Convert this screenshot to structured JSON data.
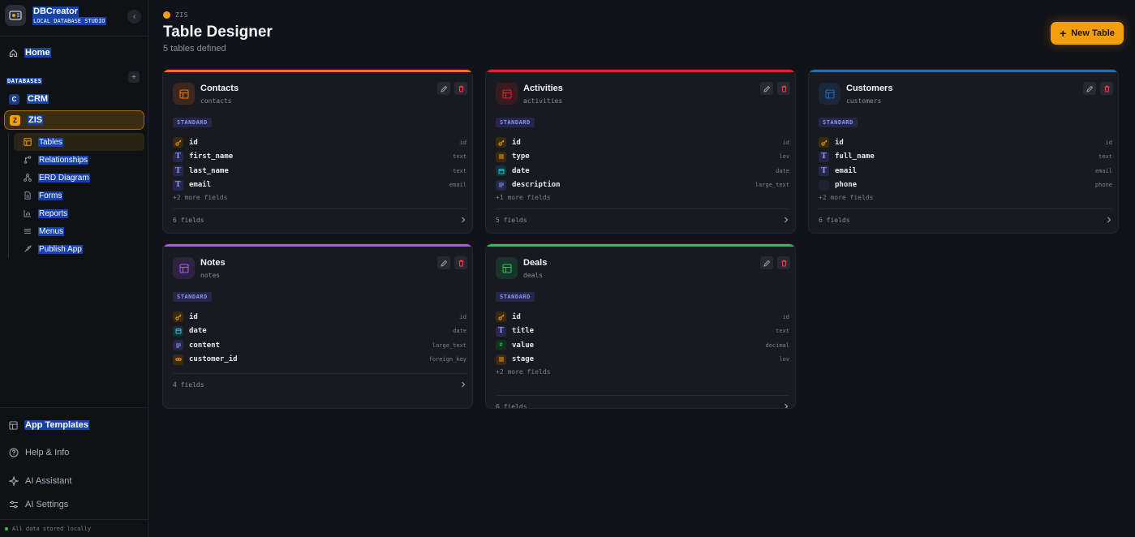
{
  "app": {
    "name": "DBCreator",
    "subtitle": "LOCAL DATABASE STUDIO"
  },
  "sidebar": {
    "home_label": "Home",
    "databases_label": "DATABASES",
    "databases": [
      {
        "letter": "C",
        "label": "CRM",
        "color": "#1e3a8a"
      },
      {
        "letter": "Z",
        "label": "ZIS",
        "color": "#f59e0b"
      }
    ],
    "sub_items": [
      {
        "label": "Tables",
        "icon": "table-icon"
      },
      {
        "label": "Relationships",
        "icon": "branch-icon"
      },
      {
        "label": "ERD Diagram",
        "icon": "diagram-icon"
      },
      {
        "label": "Forms",
        "icon": "form-icon"
      },
      {
        "label": "Reports",
        "icon": "chart-icon"
      },
      {
        "label": "Menus",
        "icon": "menu-icon"
      },
      {
        "label": "Publish App",
        "icon": "rocket-icon"
      }
    ],
    "bottom": {
      "templates": "App Templates",
      "help": "Help & Info",
      "assistant": "AI Assistant",
      "settings": "AI Settings"
    },
    "footer": "All data stored locally"
  },
  "header": {
    "crumb": "ZIS",
    "title": "Table Designer",
    "subtitle": "5 tables defined",
    "new_button": "New Table"
  },
  "tables": [
    {
      "name": "Contacts",
      "slug": "contacts",
      "color": "#f97316",
      "badge": "STANDARD",
      "fields": [
        {
          "name": "id",
          "type": "id",
          "kind": "key"
        },
        {
          "name": "first_name",
          "type": "text",
          "kind": "text"
        },
        {
          "name": "last_name",
          "type": "text",
          "kind": "text"
        },
        {
          "name": "email",
          "type": "email",
          "kind": "text"
        }
      ],
      "more": "+2 more fields",
      "count": "6 fields"
    },
    {
      "name": "Activities",
      "slug": "activities",
      "color": "#dc2626",
      "badge": "STANDARD",
      "fields": [
        {
          "name": "id",
          "type": "id",
          "kind": "key"
        },
        {
          "name": "type",
          "type": "lov",
          "kind": "lov"
        },
        {
          "name": "date",
          "type": "date",
          "kind": "date"
        },
        {
          "name": "description",
          "type": "large_text",
          "kind": "large"
        }
      ],
      "more": "+1 more fields",
      "count": "5 fields"
    },
    {
      "name": "Customers",
      "slug": "customers",
      "color": "#1d6fb8",
      "badge": "STANDARD",
      "fields": [
        {
          "name": "id",
          "type": "id",
          "kind": "key"
        },
        {
          "name": "full_name",
          "type": "text",
          "kind": "text"
        },
        {
          "name": "email",
          "type": "email",
          "kind": "text"
        },
        {
          "name": "phone",
          "type": "phone",
          "kind": "phone"
        }
      ],
      "more": "+2 more fields",
      "count": "6 fields"
    },
    {
      "name": "Notes",
      "slug": "notes",
      "color": "#a855f7",
      "badge": "STANDARD",
      "fields": [
        {
          "name": "id",
          "type": "id",
          "kind": "key"
        },
        {
          "name": "date",
          "type": "date",
          "kind": "date"
        },
        {
          "name": "content",
          "type": "large_text",
          "kind": "large"
        },
        {
          "name": "customer_id",
          "type": "foreign_key",
          "kind": "fk"
        }
      ],
      "more": "",
      "count": "4 fields"
    },
    {
      "name": "Deals",
      "slug": "deals",
      "color": "#22c55e",
      "badge": "STANDARD",
      "fields": [
        {
          "name": "id",
          "type": "id",
          "kind": "key"
        },
        {
          "name": "title",
          "type": "text",
          "kind": "text"
        },
        {
          "name": "value",
          "type": "decimal",
          "kind": "decimal"
        },
        {
          "name": "stage",
          "type": "lov",
          "kind": "lov"
        }
      ],
      "more": "+2 more fields",
      "count": "6 fields"
    }
  ]
}
